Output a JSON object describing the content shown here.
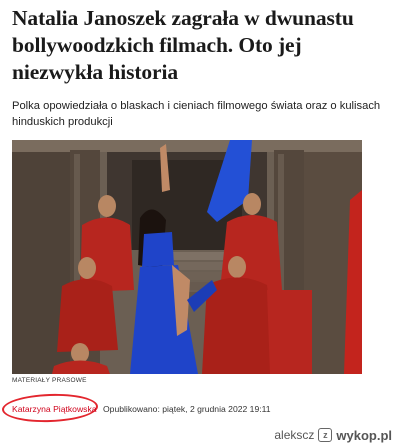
{
  "article": {
    "headline": "Natalia Janoszek zagrała w dwunastu bollywoodzkich filmach. Oto jej niezwykła historia",
    "lead": "Polka opowiedziała o blaskach i cieniach filmowego świata oraz o kulisach hinduskich produkcji",
    "photo_credit": "MATERIAŁY PRASOWE",
    "author": "Katarzyna Piątkowska",
    "published": "Opublikowano: piątek, 2 grudnia 2022 19:11"
  },
  "annotation": {
    "color": "#e3262e"
  },
  "watermark": {
    "user": "alekscz",
    "logo_letter": "z",
    "site": "wykop.pl"
  },
  "colors": {
    "author_link": "#d0021b",
    "robes": "#b7261f",
    "dress": "#1f44c9"
  }
}
